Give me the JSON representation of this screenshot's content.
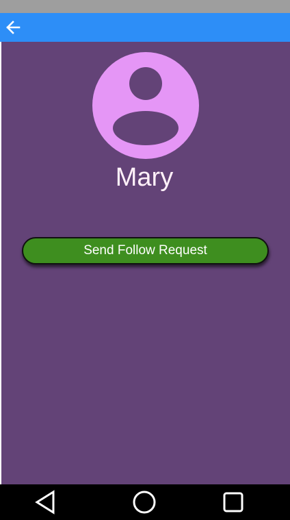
{
  "status_bar": {},
  "app_bar": {
    "back_icon": "arrow-left-icon",
    "color": "#2d8ef7"
  },
  "profile": {
    "avatar_icon": "account-circle-icon",
    "avatar_color": "#e596f6",
    "name": "Mary",
    "background_color": "#634377"
  },
  "actions": {
    "follow_label": "Send Follow Request",
    "follow_color": "#3e8e1f"
  },
  "nav_bar": {
    "back_icon": "triangle-back-icon",
    "home_icon": "circle-home-icon",
    "recents_icon": "square-recents-icon"
  }
}
